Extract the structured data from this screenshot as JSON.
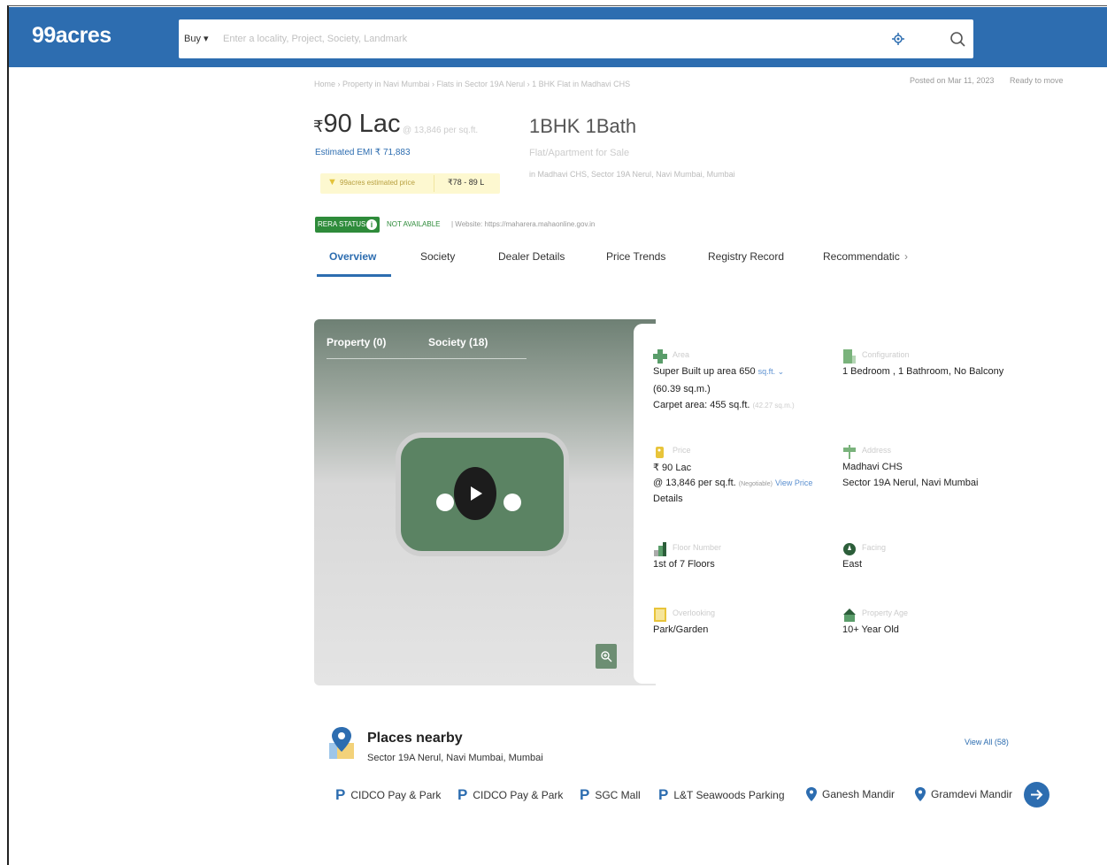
{
  "header": {
    "logo": "99acres",
    "search": {
      "mode": "Buy",
      "placeholder": "Enter a locality, Project, Society, Landmark"
    }
  },
  "meta": {
    "breadcrumb": "Home › Property in Navi Mumbai › Flats in Sector 19A Nerul › 1 BHK Flat in Madhavi CHS",
    "posted": "Posted on Mar 11, 2023",
    "status": "Ready to move"
  },
  "pricing": {
    "price_symbol": "₹",
    "price": "90 Lac",
    "per_sqft": "@ 13,846 per sq.ft.",
    "emi": "Estimated EMI ₹ 71,883",
    "estimate_label": "99acres estimated price",
    "estimate_range": "₹78 - 89 L"
  },
  "title": {
    "config": "1BHK 1Bath",
    "subtype": "Flat/Apartment for Sale",
    "address": "in Madhavi CHS, Sector 19A Nerul, Navi Mumbai, Mumbai"
  },
  "rera": {
    "badge": "RERA STATUS",
    "info": "i",
    "status": "NOT AVAILABLE",
    "website": "| Website: https://maharera.mahaonline.gov.in"
  },
  "tabs": [
    "Overview",
    "Society",
    "Dealer Details",
    "Price Trends",
    "Registry Record",
    "Recommendatic",
    "›"
  ],
  "media": {
    "tabs": [
      "Property (0)",
      "Society (18)"
    ]
  },
  "details": {
    "area": {
      "label": "Area",
      "value": "Super Built up area 650",
      "unit": "sq.ft. ⌄",
      "sub": "(60.39 sq.m.)",
      "carpet": "Carpet area: 455 sq.ft.",
      "carpet_sub": "(42.27 sq.m.)"
    },
    "configuration": {
      "label": "Configuration",
      "value": "1 Bedroom , 1 Bathroom, No Balcony"
    },
    "price": {
      "label": "Price",
      "value": "₹ 90 Lac",
      "per": "@ 13,846 per sq.ft.",
      "neg": "(Negotiable)",
      "link": "View Price",
      "link2": "Details"
    },
    "address": {
      "label": "Address",
      "line1": "Madhavi CHS",
      "line2": "Sector 19A Nerul, Navi Mumbai"
    },
    "floor": {
      "label": "Floor Number",
      "value": "1st  of 7 Floors"
    },
    "facing": {
      "label": "Facing",
      "value": "East"
    },
    "overlooking": {
      "label": "Overlooking",
      "value": "Park/Garden"
    },
    "age": {
      "label": "Property Age",
      "value": "10+ Year Old"
    }
  },
  "places": {
    "title": "Places nearby",
    "subtitle": "Sector 19A Nerul, Navi Mumbai, Mumbai",
    "view_all": "View All (58)",
    "items": [
      {
        "icon": "P",
        "label": "CIDCO Pay & Park"
      },
      {
        "icon": "P",
        "label": "CIDCO Pay & Park"
      },
      {
        "icon": "P",
        "label": "SGC Mall"
      },
      {
        "icon": "P",
        "label": "L&T Seawoods Parking"
      },
      {
        "icon": "pin",
        "label": "Ganesh Mandir"
      },
      {
        "icon": "pin",
        "label": "Gramdevi Mandir"
      }
    ]
  },
  "colors": {
    "brand": "#2d6db0",
    "rera_green": "#2e8b3a",
    "estimate_bg": "#fdf8d0"
  }
}
